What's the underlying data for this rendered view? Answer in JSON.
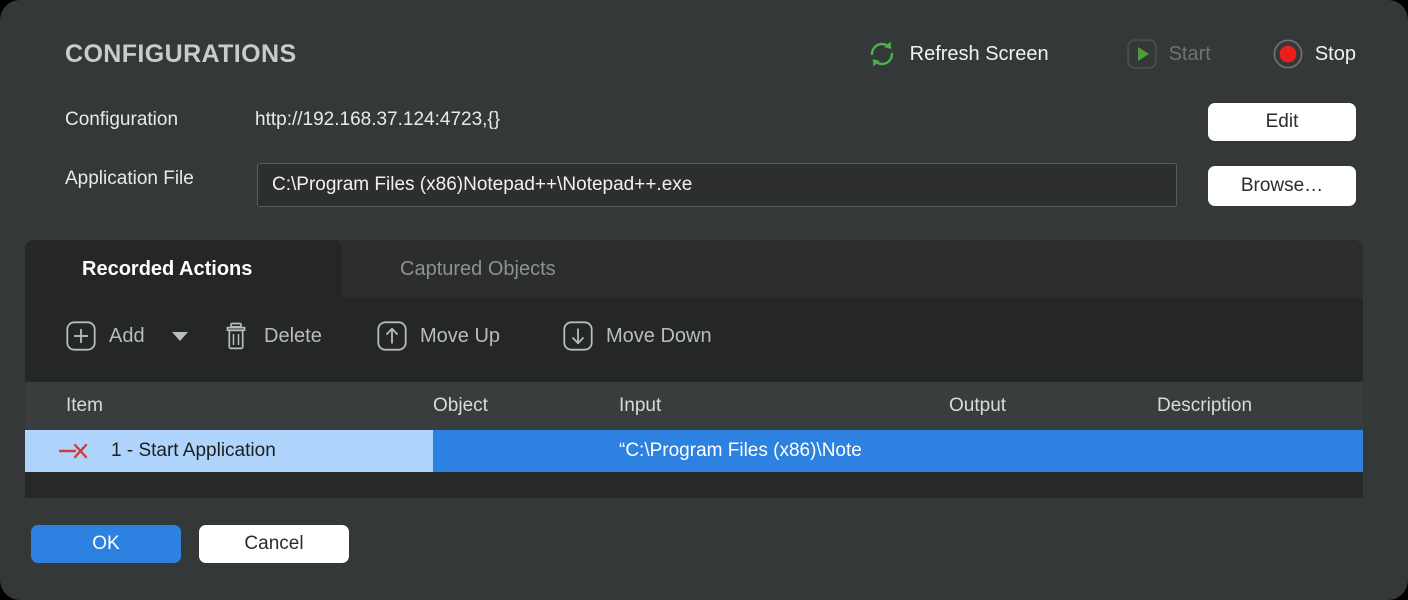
{
  "window": {
    "title": "CONFIGURATIONS"
  },
  "header_actions": {
    "refresh": {
      "label": "Refresh Screen",
      "icon": "refresh-icon",
      "color": "#4caf50"
    },
    "start": {
      "label": "Start",
      "icon": "play-icon",
      "color": "#4caf50",
      "disabled": true
    },
    "stop": {
      "label": "Stop",
      "icon": "record-stop-icon",
      "color": "#f01d1d",
      "disabled": false
    }
  },
  "form": {
    "configuration_label": "Configuration",
    "configuration_value": "http://192.168.37.124:4723,{}",
    "application_file_label": "Application File",
    "application_file_value": "C:\\Program Files (x86)Notepad++\\Notepad++.exe",
    "application_file_placeholder": "",
    "edit_button": "Edit",
    "browse_button": "Browse…"
  },
  "tabs": [
    {
      "label": "Recorded Actions",
      "active": true
    },
    {
      "label": "Captured Objects",
      "active": false
    }
  ],
  "toolbar": [
    {
      "label": "Add",
      "icon": "plus-box-icon",
      "has_caret": true
    },
    {
      "label": "Delete",
      "icon": "trash-icon",
      "has_caret": false
    },
    {
      "label": "Move Up",
      "icon": "arrow-up-box-icon",
      "has_caret": false
    },
    {
      "label": "Move Down",
      "icon": "arrow-down-box-icon",
      "has_caret": false
    }
  ],
  "table": {
    "columns": [
      "Item",
      "Object",
      "Input",
      "Output",
      "Description"
    ],
    "rows": [
      {
        "item": "1 - Start Application",
        "item_icon": "line-x-icon",
        "object": "",
        "input": "“C:\\Program Files (x86)\\Note",
        "output": "",
        "description": "",
        "selected": true
      }
    ]
  },
  "footer": {
    "ok_button": "OK",
    "cancel_button": "Cancel"
  },
  "colors": {
    "window_bg": "#353839",
    "panel_bg": "#2b2d2e",
    "toolbar_bg": "#242627",
    "table_header_bg": "#3a3d3e",
    "selection_blue": "#2d81e0",
    "selection_light_blue": "#aed4fb",
    "accent_green": "#4caf50",
    "accent_red": "#f01d1d"
  }
}
